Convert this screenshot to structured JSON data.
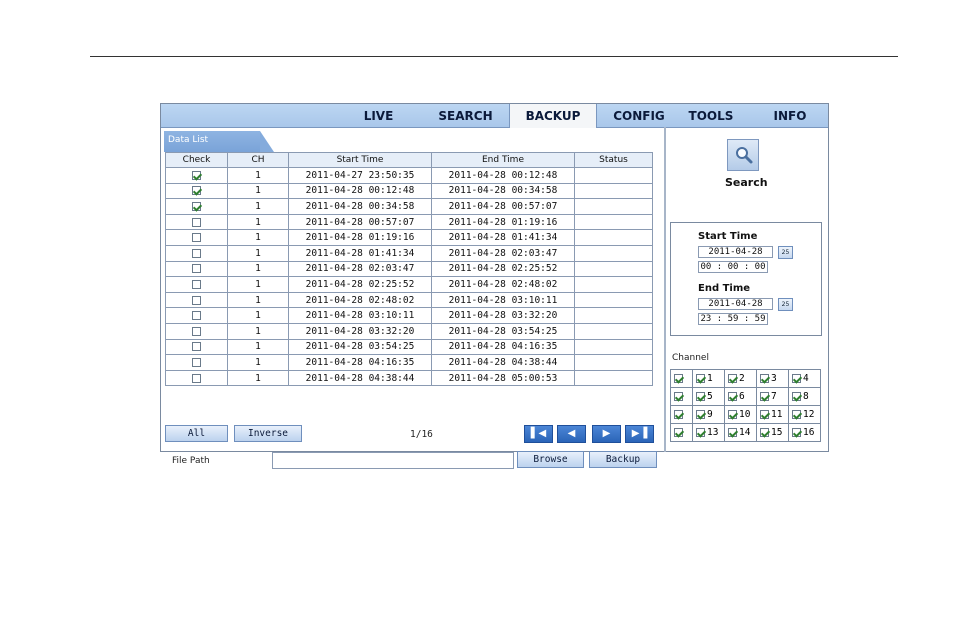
{
  "nav": {
    "tabs": [
      {
        "label": "LIVE",
        "active": false
      },
      {
        "label": "SEARCH",
        "active": false
      },
      {
        "label": "BACKUP",
        "active": true
      },
      {
        "label": "CONFIG",
        "active": false
      },
      {
        "label": "TOOLS",
        "active": false
      },
      {
        "label": "INFO",
        "active": false
      }
    ]
  },
  "data_list": {
    "tab_label": "Data List",
    "columns": [
      "Check",
      "CH",
      "Start Time",
      "End Time",
      "Status"
    ],
    "rows": [
      {
        "checked": true,
        "ch": "1",
        "start": "2011-04-27 23:50:35",
        "end": "2011-04-28 00:12:48",
        "status": ""
      },
      {
        "checked": true,
        "ch": "1",
        "start": "2011-04-28 00:12:48",
        "end": "2011-04-28 00:34:58",
        "status": ""
      },
      {
        "checked": true,
        "ch": "1",
        "start": "2011-04-28 00:34:58",
        "end": "2011-04-28 00:57:07",
        "status": ""
      },
      {
        "checked": false,
        "ch": "1",
        "start": "2011-04-28 00:57:07",
        "end": "2011-04-28 01:19:16",
        "status": ""
      },
      {
        "checked": false,
        "ch": "1",
        "start": "2011-04-28 01:19:16",
        "end": "2011-04-28 01:41:34",
        "status": ""
      },
      {
        "checked": false,
        "ch": "1",
        "start": "2011-04-28 01:41:34",
        "end": "2011-04-28 02:03:47",
        "status": ""
      },
      {
        "checked": false,
        "ch": "1",
        "start": "2011-04-28 02:03:47",
        "end": "2011-04-28 02:25:52",
        "status": ""
      },
      {
        "checked": false,
        "ch": "1",
        "start": "2011-04-28 02:25:52",
        "end": "2011-04-28 02:48:02",
        "status": ""
      },
      {
        "checked": false,
        "ch": "1",
        "start": "2011-04-28 02:48:02",
        "end": "2011-04-28 03:10:11",
        "status": ""
      },
      {
        "checked": false,
        "ch": "1",
        "start": "2011-04-28 03:10:11",
        "end": "2011-04-28 03:32:20",
        "status": ""
      },
      {
        "checked": false,
        "ch": "1",
        "start": "2011-04-28 03:32:20",
        "end": "2011-04-28 03:54:25",
        "status": ""
      },
      {
        "checked": false,
        "ch": "1",
        "start": "2011-04-28 03:54:25",
        "end": "2011-04-28 04:16:35",
        "status": ""
      },
      {
        "checked": false,
        "ch": "1",
        "start": "2011-04-28 04:16:35",
        "end": "2011-04-28 04:38:44",
        "status": ""
      },
      {
        "checked": false,
        "ch": "1",
        "start": "2011-04-28 04:38:44",
        "end": "2011-04-28 05:00:53",
        "status": ""
      }
    ]
  },
  "controls": {
    "all_label": "All",
    "inverse_label": "Inverse",
    "page_info": "1/16",
    "file_path_label": "File Path",
    "file_path_value": "",
    "browse_label": "Browse",
    "backup_label": "Backup",
    "nav_icons": [
      "first-page-icon",
      "prev-page-icon",
      "next-page-icon",
      "last-page-icon"
    ]
  },
  "search_panel": {
    "search_label": "Search",
    "start_time_label": "Start Time",
    "start_date": "2011-04-28",
    "start_time": "00 : 00 : 00",
    "end_time_label": "End Time",
    "end_date": "2011-04-28",
    "end_time": "23 : 59 : 59",
    "calendar_glyph": "25"
  },
  "channels": {
    "label": "Channel",
    "select_all_checked": true,
    "items": [
      {
        "n": "1",
        "checked": true
      },
      {
        "n": "2",
        "checked": true
      },
      {
        "n": "3",
        "checked": true
      },
      {
        "n": "4",
        "checked": true
      },
      {
        "n": "5",
        "checked": true
      },
      {
        "n": "6",
        "checked": true
      },
      {
        "n": "7",
        "checked": true
      },
      {
        "n": "8",
        "checked": true
      },
      {
        "n": "9",
        "checked": true
      },
      {
        "n": "10",
        "checked": true
      },
      {
        "n": "11",
        "checked": true
      },
      {
        "n": "12",
        "checked": true
      },
      {
        "n": "13",
        "checked": true
      },
      {
        "n": "14",
        "checked": true
      },
      {
        "n": "15",
        "checked": true
      },
      {
        "n": "16",
        "checked": true
      }
    ]
  },
  "colors": {
    "nav_bg": "#a9c7ea",
    "accent_blue": "#2a64b8",
    "check_green": "#2f7f2f"
  }
}
